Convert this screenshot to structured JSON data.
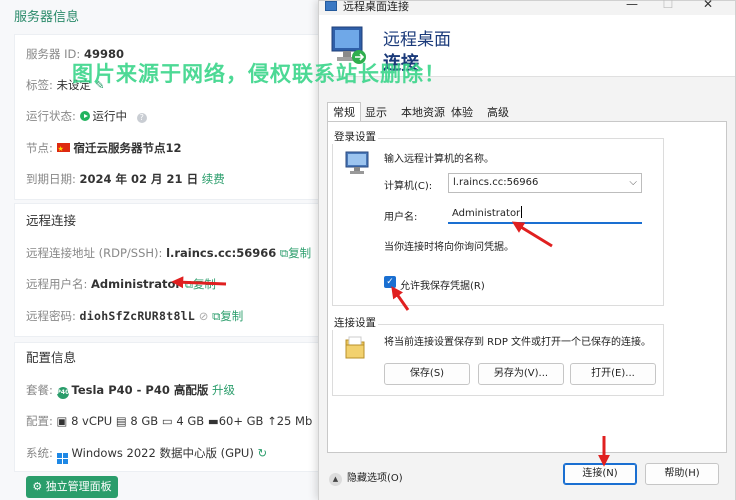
{
  "server_info": {
    "title": "服务器信息",
    "id_label": "服务器 ID:",
    "id_value": "49980",
    "tag_label": "标签:",
    "tag_value": "未设定",
    "status_label": "运行状态:",
    "status_value": "运行中",
    "node_label": "节点:",
    "node_value": "宿迁云服务器节点12",
    "expire_label": "到期日期:",
    "expire_value": "2024 年 02 月 21 日",
    "renew_label": "续费"
  },
  "remote": {
    "title": "远程连接",
    "addr_label": "远程连接地址 (RDP/SSH):",
    "addr_value": "l.raincs.cc:56966",
    "copy_label": "复制",
    "user_label": "远程用户名:",
    "user_value": "Administrator",
    "user_copy_label": "复制",
    "pwd_label": "远程密码:",
    "pwd_value": "diohSfZcRUR8t8lL",
    "pwd_copy_label": "复制"
  },
  "config": {
    "title": "配置信息",
    "plan_label": "套餐:",
    "plan_value": "Tesla P40 - P40 高配版",
    "upgrade_label": "升级",
    "spec_label": "配置:",
    "specs": [
      "8 vCPU",
      "8 GB",
      "4 GB",
      "60+ GB",
      "25 Mb"
    ],
    "os_label": "系统:",
    "os_value": "Windows 2022 数据中心版 (GPU)",
    "manage_button": "独立管理面板"
  },
  "watermark": "图片来源于网络，侵权联系站长删除！",
  "rdp": {
    "window_title": "远程桌面连接",
    "header_line1": "远程桌面",
    "header_line2": "连接",
    "tabs": [
      "常规",
      "显示",
      "本地资源",
      "体验",
      "高级"
    ],
    "login_group": "登录设置",
    "prompt": "输入远程计算机的名称。",
    "computer_label": "计算机(C):",
    "computer_value": "l.raincs.cc:56966",
    "username_label": "用户名:",
    "username_value": "Administrator",
    "credentials_note": "当你连接时将向你询问凭据。",
    "allow_save_label": "允许我保存凭据(R)",
    "allow_save_checked": true,
    "connect_group": "连接设置",
    "connect_desc": "将当前连接设置保存到 RDP 文件或打开一个已保存的连接。",
    "save_button": "保存(S)",
    "save_as_button": "另存为(V)...",
    "open_button": "打开(E)...",
    "hide_options": "隐藏选项(O)",
    "connect_button": "连接(N)",
    "help_button": "帮助(H)"
  },
  "colors": {
    "accent_green": "#2a9d6b",
    "accent_blue": "#1a6fd1",
    "arrow_red": "#e02020",
    "watermark": "#2ed282"
  }
}
